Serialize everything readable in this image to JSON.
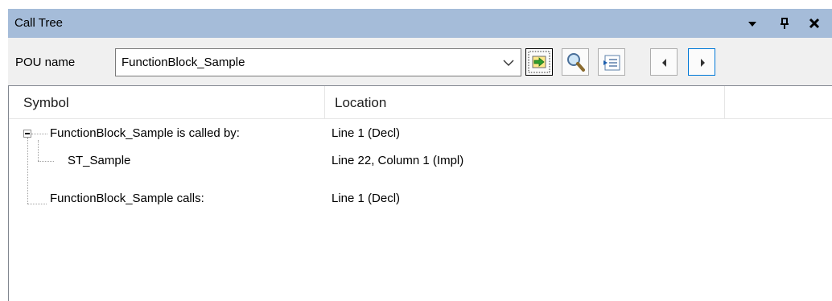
{
  "window": {
    "title": "Call Tree"
  },
  "window_controls": [
    "dropdown-icon",
    "pin-icon",
    "close-icon"
  ],
  "toolbar": {
    "pou_label": "POU name",
    "pou_value": "FunctionBlock_Sample",
    "buttons": [
      {
        "name": "go-button",
        "icon": "arrow-right-icon"
      },
      {
        "name": "find-button",
        "icon": "magnifier-icon"
      },
      {
        "name": "expand-button",
        "icon": "list-expand-icon"
      },
      {
        "name": "previous-button",
        "icon": "triangle-left-icon"
      },
      {
        "name": "next-button",
        "icon": "triangle-right-icon"
      }
    ]
  },
  "table": {
    "columns": [
      "Symbol",
      "Location"
    ],
    "rows": [
      {
        "symbol": "FunctionBlock_Sample is called by:",
        "location": "Line 1 (Decl)",
        "level": 0,
        "expanded": true
      },
      {
        "symbol": "ST_Sample",
        "location": "Line 22, Column 1 (Impl)",
        "level": 1
      },
      {
        "symbol": "FunctionBlock_Sample calls:",
        "location": "Line 1 (Decl)",
        "level": 0
      }
    ]
  },
  "colors": {
    "titlebar": "#a5bcd9",
    "accent_green": "#2e9e2e",
    "selected_border": "#0078d7"
  }
}
